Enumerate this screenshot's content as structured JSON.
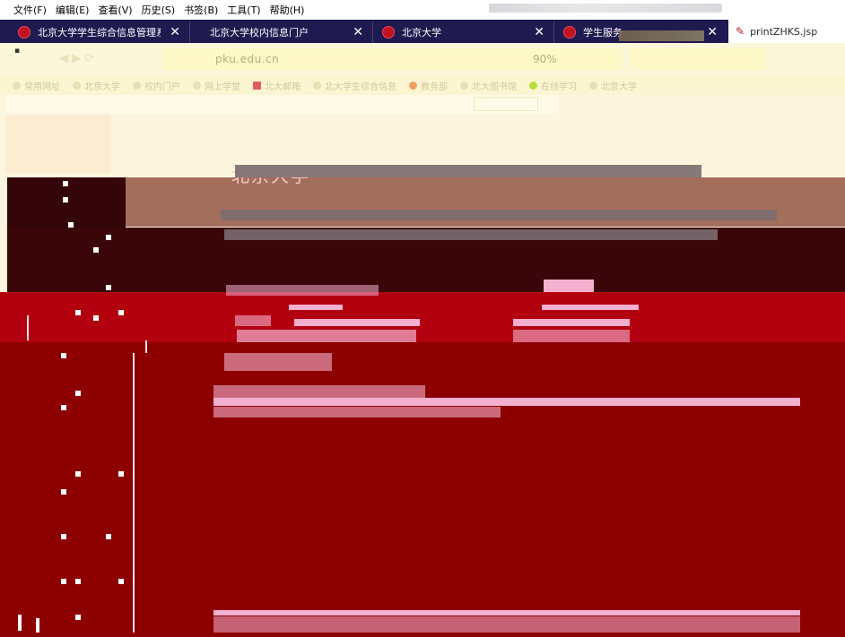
{
  "menu": [
    "文件(F)",
    "编辑(E)",
    "查看(V)",
    "历史(S)",
    "书签(B)",
    "工具(T)",
    "帮助(H)"
  ],
  "tabs": [
    {
      "title": "北京大学学生综合信息管理系统",
      "close": "✕"
    },
    {
      "title": "北京大学校内信息门户",
      "close": "✕"
    },
    {
      "title": "北京大学",
      "close": "✕"
    },
    {
      "title": "学生服务",
      "close": "✕"
    },
    {
      "title": "printZHKS.jsp"
    }
  ],
  "address": {
    "url": "pku.edu.cn",
    "zoom": "90%"
  },
  "bookmarks": [
    {
      "label": "常用网址",
      "icon": "page"
    },
    {
      "label": "北京大学",
      "icon": "page"
    },
    {
      "label": "校内门户",
      "icon": "page"
    },
    {
      "label": "网上学堂",
      "icon": "page"
    },
    {
      "label": "北大邮箱",
      "icon": "red"
    },
    {
      "label": "北大学生综合信息",
      "icon": "page"
    },
    {
      "label": "教务部",
      "icon": "orange"
    },
    {
      "label": "北大图书馆",
      "icon": "page"
    },
    {
      "label": "在线学习",
      "icon": "green"
    },
    {
      "label": "北京大学",
      "icon": "page"
    }
  ],
  "colors": {
    "tabstrip": "#1f1a4f",
    "toolbar": "#fbf7d9",
    "page_bg": "#fdf6de",
    "pku_red": "#b3000f",
    "dark_red": "#8d0000",
    "maroon": "#3a060a",
    "brown": "#a46e5c",
    "highlight_pink": "#f4b0cf"
  }
}
